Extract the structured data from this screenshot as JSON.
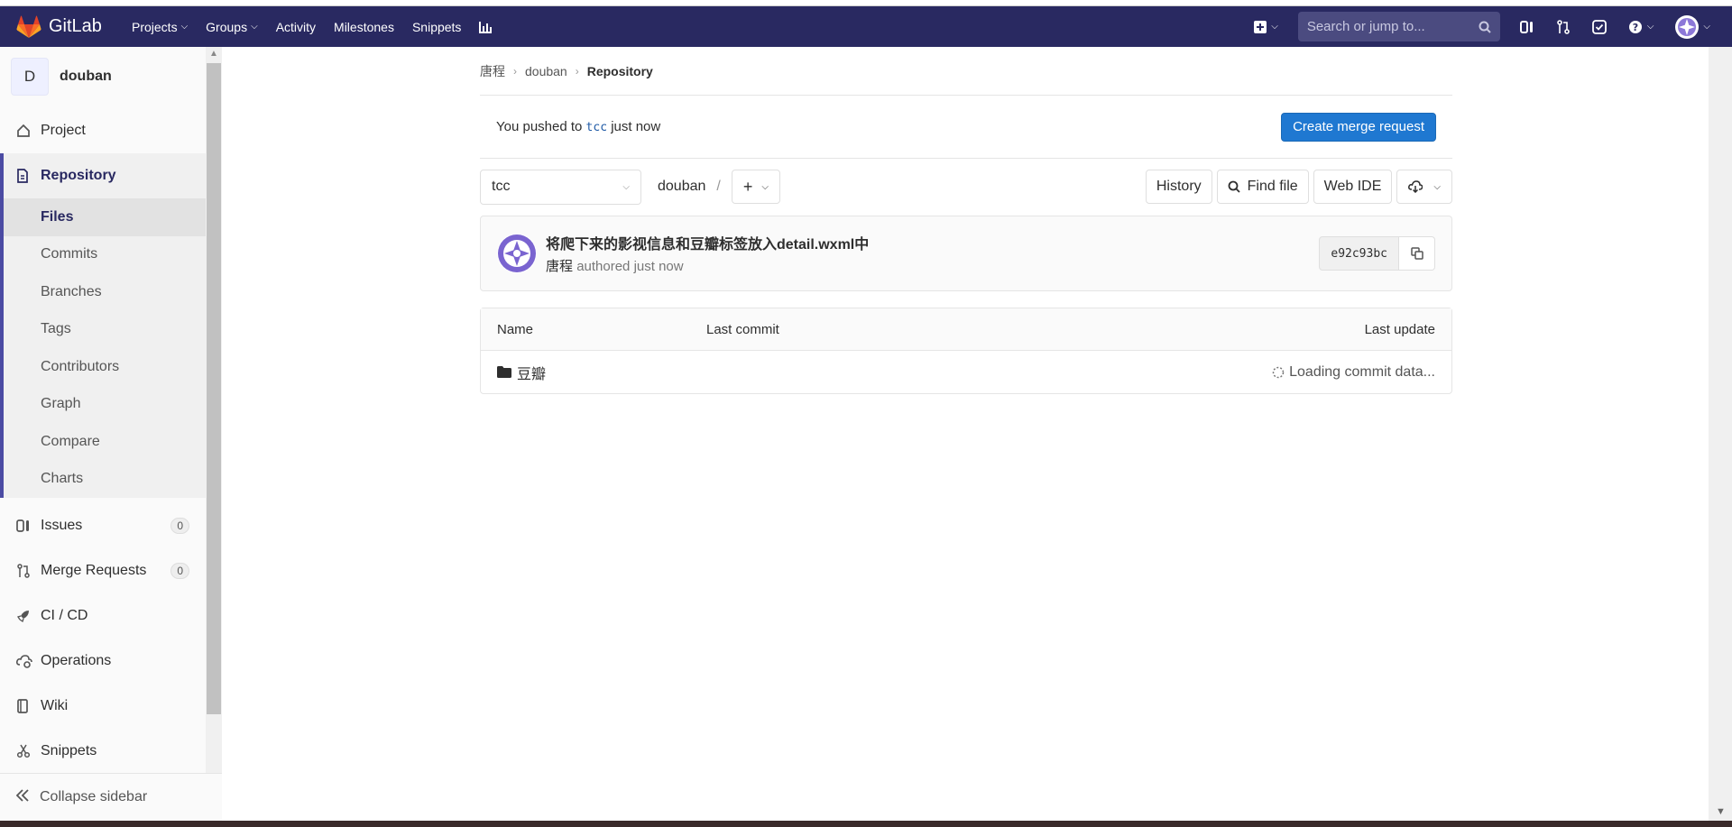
{
  "navbar": {
    "brand": "GitLab",
    "links": [
      {
        "label": "Projects",
        "caret": true
      },
      {
        "label": "Groups",
        "caret": true
      },
      {
        "label": "Activity",
        "caret": false
      },
      {
        "label": "Milestones",
        "caret": false
      },
      {
        "label": "Snippets",
        "caret": false
      }
    ],
    "search_placeholder": "Search or jump to...",
    "icons": [
      "plus-square-icon",
      "search-icon",
      "issues-icon",
      "merge-request-icon",
      "todo-icon",
      "help-icon",
      "user-avatar"
    ]
  },
  "sidebar": {
    "project_letter": "D",
    "project_name": "douban",
    "items": {
      "project": "Project",
      "repository": "Repository",
      "issues": "Issues",
      "issues_count": "0",
      "merge_requests": "Merge Requests",
      "merge_requests_count": "0",
      "cicd": "CI / CD",
      "operations": "Operations",
      "wiki": "Wiki",
      "snippets": "Snippets"
    },
    "repository_sub": {
      "files": "Files",
      "commits": "Commits",
      "branches": "Branches",
      "tags": "Tags",
      "contributors": "Contributors",
      "graph": "Graph",
      "compare": "Compare",
      "charts": "Charts"
    },
    "collapse": "Collapse sidebar"
  },
  "breadcrumb": {
    "owner": "唐程",
    "project": "douban",
    "current": "Repository"
  },
  "push": {
    "prefix": "You pushed to",
    "branch": "tcc",
    "suffix": "just now",
    "button": "Create merge request"
  },
  "tree": {
    "branch": "tcc",
    "path": "douban",
    "path_sep": "/",
    "buttons": {
      "history": "History",
      "find_file": "Find file",
      "web_ide": "Web IDE"
    }
  },
  "commit": {
    "title": "将爬下来的影视信息和豆瓣标签放入detail.wxml中",
    "author": "唐程",
    "meta": "authored just now",
    "sha": "e92c93bc"
  },
  "table": {
    "headers": {
      "name": "Name",
      "last_commit": "Last commit",
      "last_update": "Last update"
    },
    "rows": [
      {
        "name": "豆瓣",
        "status": "Loading commit data..."
      }
    ]
  },
  "colors": {
    "navbar": "#292961",
    "primary": "#1f78d1",
    "sidebar_accent": "#4b4ba3"
  }
}
